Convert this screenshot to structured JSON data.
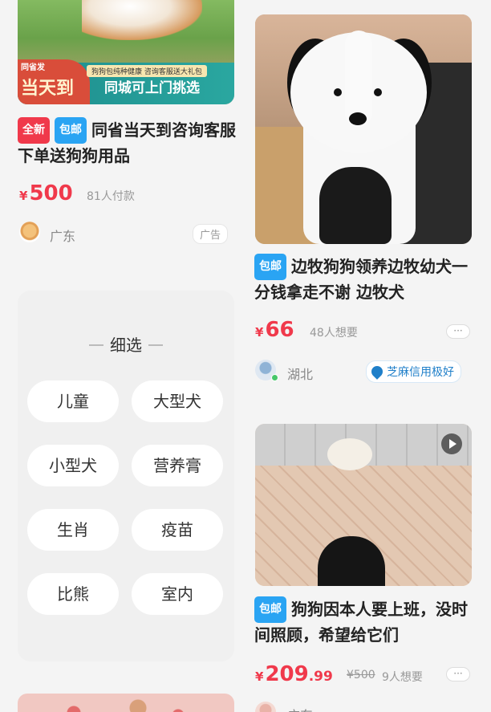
{
  "left_card": {
    "image": {
      "corner_text": "同省发",
      "small_banner": "狗狗包纯种健康 咨询客服送大礼包",
      "big_text": "当天到",
      "right_text": "同城可上门挑选"
    },
    "badges": [
      "全新",
      "包邮"
    ],
    "title": "同省当天到咨询客服下单送狗狗用品",
    "price_symbol": "¥",
    "price": "500",
    "meta": "81人付款",
    "location": "广东",
    "ad_label": "广告"
  },
  "filter_panel": {
    "title": "细选",
    "chips": [
      "儿童",
      "大型犬",
      "小型犬",
      "营养膏",
      "生肖",
      "疫苗",
      "比熊",
      "室内"
    ]
  },
  "right_card_1": {
    "badges": [
      "包邮"
    ],
    "title": "边牧狗狗领养边牧幼犬一分钱拿走不谢 边牧犬",
    "price_symbol": "¥",
    "price": "66",
    "meta": "48人想要",
    "more": "···",
    "location": "湖北",
    "credit": "芝麻信用极好"
  },
  "right_card_2": {
    "badges": [
      "包邮"
    ],
    "title": "狗狗因本人要上班，没时间照顾，希望给它们",
    "price_symbol": "¥",
    "price_int": "209",
    "price_cents": ".99",
    "original_price": "¥500",
    "meta": "9人想要",
    "more": "···",
    "location": "广东"
  },
  "colors": {
    "price": "#f0394b",
    "badge_new": "#f0394b",
    "badge_free": "#2aa4f3",
    "credit": "#1f7fc9"
  },
  "icons": [
    "corgi-avatar-icon",
    "user-avatar-icon",
    "sesame-credit-icon",
    "play-video-icon",
    "more-options-icon"
  ]
}
